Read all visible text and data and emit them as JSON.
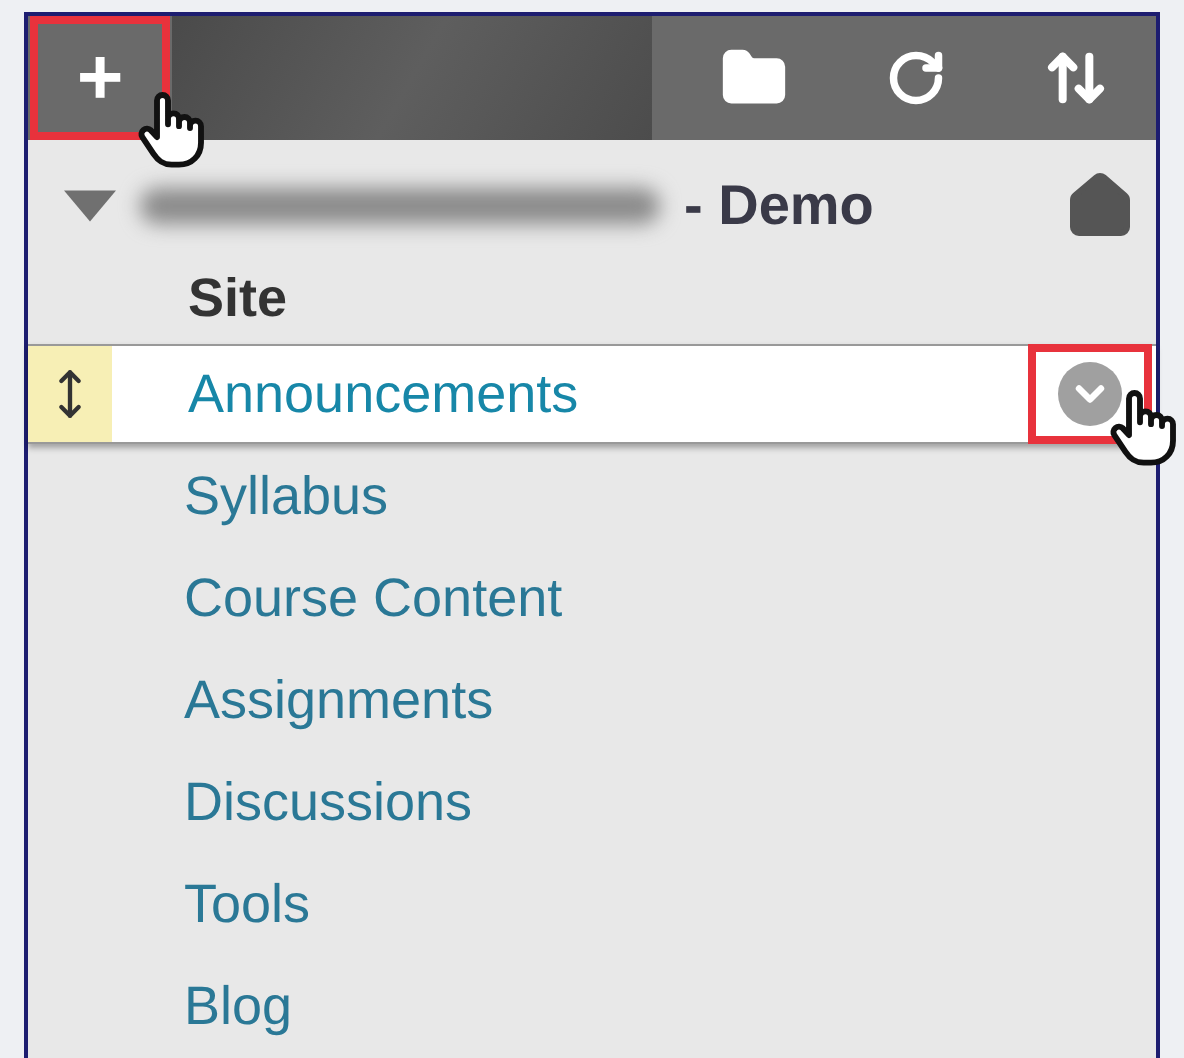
{
  "toolbar": {
    "add_button": {
      "label": "+",
      "highlighted": true
    }
  },
  "course": {
    "title": "- Demo",
    "expanded": true
  },
  "section": "Site",
  "items": [
    {
      "label": "Announcements",
      "selected": true
    },
    {
      "label": "Syllabus",
      "selected": false
    },
    {
      "label": "Course Content",
      "selected": false
    },
    {
      "label": "Assignments",
      "selected": false
    },
    {
      "label": "Discussions",
      "selected": false
    },
    {
      "label": "Tools",
      "selected": false
    },
    {
      "label": "Blog",
      "selected": false
    }
  ]
}
